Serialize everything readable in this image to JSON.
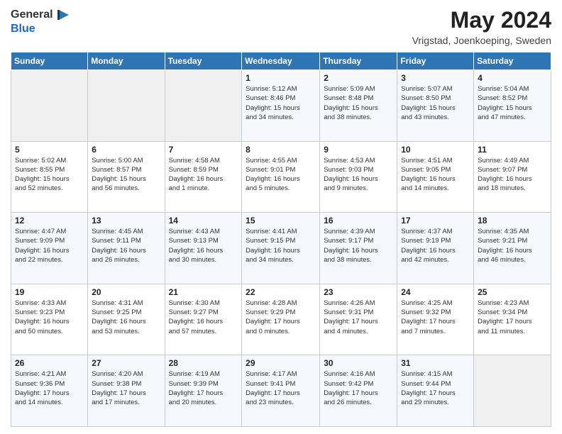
{
  "header": {
    "logo_general": "General",
    "logo_blue": "Blue",
    "title": "May 2024",
    "subtitle": "Vrigstad, Joenkoeping, Sweden"
  },
  "calendar": {
    "days_of_week": [
      "Sunday",
      "Monday",
      "Tuesday",
      "Wednesday",
      "Thursday",
      "Friday",
      "Saturday"
    ],
    "weeks": [
      [
        {
          "day": "",
          "info": ""
        },
        {
          "day": "",
          "info": ""
        },
        {
          "day": "",
          "info": ""
        },
        {
          "day": "1",
          "info": "Sunrise: 5:12 AM\nSunset: 8:46 PM\nDaylight: 15 hours\nand 34 minutes."
        },
        {
          "day": "2",
          "info": "Sunrise: 5:09 AM\nSunset: 8:48 PM\nDaylight: 15 hours\nand 38 minutes."
        },
        {
          "day": "3",
          "info": "Sunrise: 5:07 AM\nSunset: 8:50 PM\nDaylight: 15 hours\nand 43 minutes."
        },
        {
          "day": "4",
          "info": "Sunrise: 5:04 AM\nSunset: 8:52 PM\nDaylight: 15 hours\nand 47 minutes."
        }
      ],
      [
        {
          "day": "5",
          "info": "Sunrise: 5:02 AM\nSunset: 8:55 PM\nDaylight: 15 hours\nand 52 minutes."
        },
        {
          "day": "6",
          "info": "Sunrise: 5:00 AM\nSunset: 8:57 PM\nDaylight: 15 hours\nand 56 minutes."
        },
        {
          "day": "7",
          "info": "Sunrise: 4:58 AM\nSunset: 8:59 PM\nDaylight: 16 hours\nand 1 minute."
        },
        {
          "day": "8",
          "info": "Sunrise: 4:55 AM\nSunset: 9:01 PM\nDaylight: 16 hours\nand 5 minutes."
        },
        {
          "day": "9",
          "info": "Sunrise: 4:53 AM\nSunset: 9:03 PM\nDaylight: 16 hours\nand 9 minutes."
        },
        {
          "day": "10",
          "info": "Sunrise: 4:51 AM\nSunset: 9:05 PM\nDaylight: 16 hours\nand 14 minutes."
        },
        {
          "day": "11",
          "info": "Sunrise: 4:49 AM\nSunset: 9:07 PM\nDaylight: 16 hours\nand 18 minutes."
        }
      ],
      [
        {
          "day": "12",
          "info": "Sunrise: 4:47 AM\nSunset: 9:09 PM\nDaylight: 16 hours\nand 22 minutes."
        },
        {
          "day": "13",
          "info": "Sunrise: 4:45 AM\nSunset: 9:11 PM\nDaylight: 16 hours\nand 26 minutes."
        },
        {
          "day": "14",
          "info": "Sunrise: 4:43 AM\nSunset: 9:13 PM\nDaylight: 16 hours\nand 30 minutes."
        },
        {
          "day": "15",
          "info": "Sunrise: 4:41 AM\nSunset: 9:15 PM\nDaylight: 16 hours\nand 34 minutes."
        },
        {
          "day": "16",
          "info": "Sunrise: 4:39 AM\nSunset: 9:17 PM\nDaylight: 16 hours\nand 38 minutes."
        },
        {
          "day": "17",
          "info": "Sunrise: 4:37 AM\nSunset: 9:19 PM\nDaylight: 16 hours\nand 42 minutes."
        },
        {
          "day": "18",
          "info": "Sunrise: 4:35 AM\nSunset: 9:21 PM\nDaylight: 16 hours\nand 46 minutes."
        }
      ],
      [
        {
          "day": "19",
          "info": "Sunrise: 4:33 AM\nSunset: 9:23 PM\nDaylight: 16 hours\nand 50 minutes."
        },
        {
          "day": "20",
          "info": "Sunrise: 4:31 AM\nSunset: 9:25 PM\nDaylight: 16 hours\nand 53 minutes."
        },
        {
          "day": "21",
          "info": "Sunrise: 4:30 AM\nSunset: 9:27 PM\nDaylight: 16 hours\nand 57 minutes."
        },
        {
          "day": "22",
          "info": "Sunrise: 4:28 AM\nSunset: 9:29 PM\nDaylight: 17 hours\nand 0 minutes."
        },
        {
          "day": "23",
          "info": "Sunrise: 4:26 AM\nSunset: 9:31 PM\nDaylight: 17 hours\nand 4 minutes."
        },
        {
          "day": "24",
          "info": "Sunrise: 4:25 AM\nSunset: 9:32 PM\nDaylight: 17 hours\nand 7 minutes."
        },
        {
          "day": "25",
          "info": "Sunrise: 4:23 AM\nSunset: 9:34 PM\nDaylight: 17 hours\nand 11 minutes."
        }
      ],
      [
        {
          "day": "26",
          "info": "Sunrise: 4:21 AM\nSunset: 9:36 PM\nDaylight: 17 hours\nand 14 minutes."
        },
        {
          "day": "27",
          "info": "Sunrise: 4:20 AM\nSunset: 9:38 PM\nDaylight: 17 hours\nand 17 minutes."
        },
        {
          "day": "28",
          "info": "Sunrise: 4:19 AM\nSunset: 9:39 PM\nDaylight: 17 hours\nand 20 minutes."
        },
        {
          "day": "29",
          "info": "Sunrise: 4:17 AM\nSunset: 9:41 PM\nDaylight: 17 hours\nand 23 minutes."
        },
        {
          "day": "30",
          "info": "Sunrise: 4:16 AM\nSunset: 9:42 PM\nDaylight: 17 hours\nand 26 minutes."
        },
        {
          "day": "31",
          "info": "Sunrise: 4:15 AM\nSunset: 9:44 PM\nDaylight: 17 hours\nand 29 minutes."
        },
        {
          "day": "",
          "info": ""
        }
      ]
    ]
  }
}
